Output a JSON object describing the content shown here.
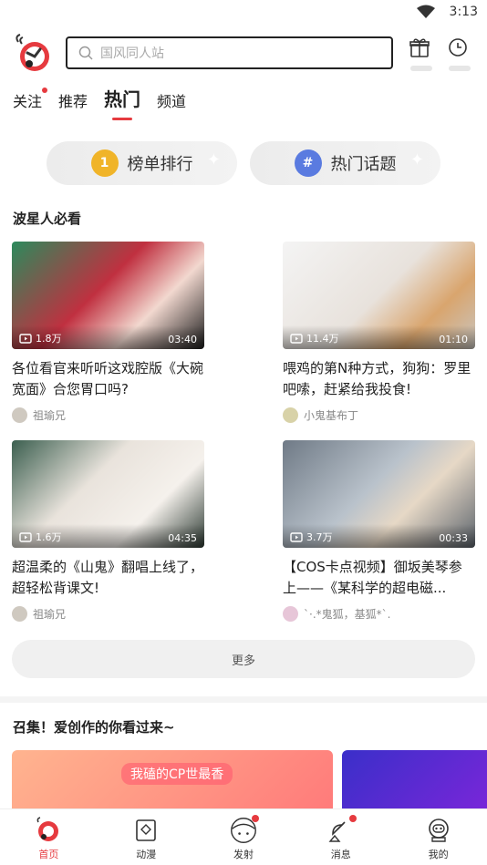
{
  "status_bar": {
    "time": "3:13",
    "icons": [
      "wifi-icon",
      "battery-icon"
    ]
  },
  "header": {
    "search_placeholder": "国风同人站"
  },
  "tabs": [
    {
      "label": "关注",
      "active": false,
      "dot": true
    },
    {
      "label": "推荐",
      "active": false
    },
    {
      "label": "热门",
      "active": true
    },
    {
      "label": "频道",
      "active": false
    }
  ],
  "pills": [
    {
      "label": "榜单排行",
      "icon": "medal-icon"
    },
    {
      "label": "热门话题",
      "icon": "hashtag-icon"
    }
  ],
  "section1": {
    "title": "波星人必看"
  },
  "videos": [
    {
      "views": "1.8万",
      "duration": "03:40",
      "title": "各位看官来听听这戏腔版《大碗宽面》合您胃口吗?",
      "author": "祖瑜兄"
    },
    {
      "views": "11.4万",
      "duration": "01:10",
      "title": "喂鸡的第N种方式，狗狗：罗里吧嗦，赶紧给我投食!",
      "author": "小鬼基布丁"
    },
    {
      "views": "1.6万",
      "duration": "04:35",
      "title": "超温柔的《山鬼》翻唱上线了，超轻松背课文!",
      "author": "祖瑜兄"
    },
    {
      "views": "3.7万",
      "duration": "00:33",
      "title": "【COS卡点视频】御坂美琴参上——《某科学的超电磁...",
      "author": "`·.*鬼狐，基狐*`."
    }
  ],
  "more_label": "更多",
  "section2": {
    "title": "召集！爱创作的你看过来~"
  },
  "banner": {
    "text": "我磕的CP世最香"
  },
  "bottom_nav": [
    {
      "label": "首页",
      "active": true,
      "icon": "home-rocket-icon"
    },
    {
      "label": "动漫",
      "active": false,
      "icon": "anime-book-icon"
    },
    {
      "label": "发射",
      "active": false,
      "icon": "launch-face-icon",
      "dot": true
    },
    {
      "label": "消息",
      "active": false,
      "icon": "satellite-icon",
      "dot": true
    },
    {
      "label": "我的",
      "active": false,
      "icon": "astronaut-icon"
    }
  ],
  "colors": {
    "accent": "#e63a3f"
  }
}
